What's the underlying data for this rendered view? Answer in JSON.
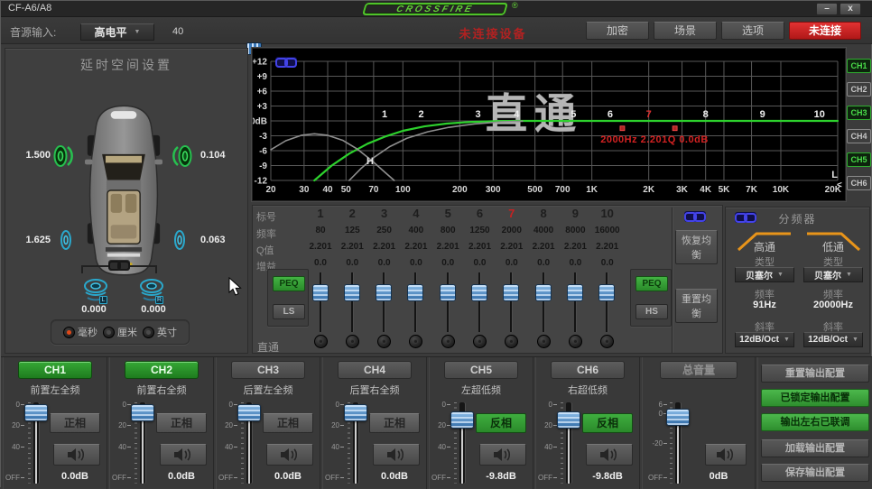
{
  "window": {
    "title": "CF-A6/A8",
    "logo_text": "CROSSFIRE",
    "logo_reg": "®",
    "minimize_glyph": "–",
    "close_glyph": "x"
  },
  "toolbar": {
    "source_label": "音源输入:",
    "source_select": {
      "value": "高电平"
    },
    "gain_value": "40",
    "status_text": "未连接设备",
    "encrypt_button": "加密",
    "scene_button": "场景",
    "options_button": "选项",
    "connect_button": "未连接"
  },
  "delay_panel": {
    "title": "延时空间设置",
    "values": {
      "front_left": "1.500",
      "front_right": "0.104",
      "rear_left": "1.625",
      "rear_right": "0.063",
      "sub_left": "0.000",
      "sub_right": "0.000"
    },
    "sub_tags": {
      "left": "L",
      "right": "R"
    },
    "units": [
      {
        "label": "毫秒",
        "selected": true
      },
      {
        "label": "厘米",
        "selected": false
      },
      {
        "label": "英寸",
        "selected": false
      }
    ]
  },
  "graph": {
    "watermark": "直通",
    "selected_band_info": "2000Hz 2.201Q 0.0dB",
    "high_label": "H",
    "low_label": "L",
    "collapse_arrow": "<",
    "channel_buttons": [
      {
        "label": "CH1",
        "active": true
      },
      {
        "label": "CH2",
        "active": false
      },
      {
        "label": "CH3",
        "active": true
      },
      {
        "label": "CH4",
        "active": false
      },
      {
        "label": "CH5",
        "active": true
      },
      {
        "label": "CH6",
        "active": false
      }
    ]
  },
  "chart_data": {
    "type": "line",
    "x_scale": "log",
    "x_range": [
      20,
      20000
    ],
    "y_range": [
      -12,
      12
    ],
    "y_unit": "dB",
    "x_ticks": [
      [
        20,
        "20"
      ],
      [
        30,
        "30"
      ],
      [
        40,
        "40"
      ],
      [
        50,
        "50"
      ],
      [
        70,
        "70"
      ],
      [
        100,
        "100"
      ],
      [
        200,
        "200"
      ],
      [
        300,
        "300"
      ],
      [
        500,
        "500"
      ],
      [
        700,
        "700"
      ],
      [
        1000,
        "1K"
      ],
      [
        2000,
        "2K"
      ],
      [
        3000,
        "3K"
      ],
      [
        4000,
        "4K"
      ],
      [
        5000,
        "5K"
      ],
      [
        7000,
        "7K"
      ],
      [
        10000,
        "10K"
      ],
      [
        20000,
        "20K"
      ]
    ],
    "y_ticks": [
      [
        12,
        "+12"
      ],
      [
        9,
        "+9"
      ],
      [
        6,
        "+6"
      ],
      [
        3,
        "+3"
      ],
      [
        0,
        "0dB"
      ],
      [
        -3,
        "-3"
      ],
      [
        -6,
        "-6"
      ],
      [
        -9,
        "-9"
      ],
      [
        -12,
        "-12"
      ]
    ],
    "series": [
      {
        "name": "channel-response",
        "color": "#2dd12d",
        "width": 2.2,
        "points": [
          [
            34,
            -12
          ],
          [
            42,
            -9
          ],
          [
            52,
            -6.6
          ],
          [
            65,
            -4.6
          ],
          [
            80,
            -3.2
          ],
          [
            100,
            -2
          ],
          [
            130,
            -1.1
          ],
          [
            170,
            -0.55
          ],
          [
            230,
            -0.2
          ],
          [
            320,
            -0.05
          ],
          [
            420,
            0
          ],
          [
            20000,
            0
          ]
        ]
      },
      {
        "name": "lowpass-filter",
        "color": "#8f8f8f",
        "width": 1.6,
        "points": [
          [
            20,
            -5.8
          ],
          [
            24,
            -4
          ],
          [
            29,
            -2.9
          ],
          [
            34,
            -2.6
          ],
          [
            40,
            -2.9
          ],
          [
            48,
            -3.9
          ],
          [
            57,
            -5.6
          ],
          [
            68,
            -7.9
          ],
          [
            80,
            -10.3
          ],
          [
            90,
            -12
          ]
        ]
      },
      {
        "name": "highpass-filter",
        "color": "#8f8f8f",
        "width": 1.6,
        "points": [
          [
            52,
            -12
          ],
          [
            60,
            -9.6
          ],
          [
            70,
            -7.4
          ],
          [
            85,
            -5.2
          ],
          [
            105,
            -3.5
          ],
          [
            135,
            -2.2
          ],
          [
            175,
            -1.3
          ],
          [
            240,
            -0.6
          ],
          [
            330,
            -0.2
          ],
          [
            430,
            -0.05
          ]
        ]
      }
    ],
    "band_markers": {
      "frequencies": [
        80,
        125,
        250,
        400,
        800,
        1250,
        2000,
        4000,
        8000,
        16000
      ],
      "labels": [
        "1",
        "2",
        "3",
        "4",
        "5",
        "6",
        "7",
        "8",
        "9",
        "10"
      ],
      "selected_index": 6,
      "color": "#f0f0f0",
      "selected_color": "#e03030"
    },
    "extra_markers": [
      {
        "freq": 1450,
        "db": -1.5
      },
      {
        "freq": 2750,
        "db": -1.5
      }
    ]
  },
  "eq": {
    "row_labels": [
      "标号",
      "频率",
      "Q值",
      "增益"
    ],
    "bands": [
      {
        "num": "1",
        "freq": "80",
        "q": "2.201",
        "gain": "0.0",
        "selected": false
      },
      {
        "num": "2",
        "freq": "125",
        "q": "2.201",
        "gain": "0.0",
        "selected": false
      },
      {
        "num": "3",
        "freq": "250",
        "q": "2.201",
        "gain": "0.0",
        "selected": false
      },
      {
        "num": "4",
        "freq": "400",
        "q": "2.201",
        "gain": "0.0",
        "selected": false
      },
      {
        "num": "5",
        "freq": "800",
        "q": "2.201",
        "gain": "0.0",
        "selected": false
      },
      {
        "num": "6",
        "freq": "1250",
        "q": "2.201",
        "gain": "0.0",
        "selected": false
      },
      {
        "num": "7",
        "freq": "2000",
        "q": "2.201",
        "gain": "0.0",
        "selected": true
      },
      {
        "num": "8",
        "freq": "4000",
        "q": "2.201",
        "gain": "0.0",
        "selected": false
      },
      {
        "num": "9",
        "freq": "8000",
        "q": "2.201",
        "gain": "0.0",
        "selected": false
      },
      {
        "num": "10",
        "freq": "16000",
        "q": "2.201",
        "gain": "0.0",
        "selected": false
      }
    ],
    "left_filter_buttons": [
      {
        "label": "PEQ",
        "green": true
      },
      {
        "label": "LS",
        "green": false
      }
    ],
    "right_filter_buttons": [
      {
        "label": "PEQ",
        "green": true
      },
      {
        "label": "HS",
        "green": false
      }
    ],
    "mode_label": "直通",
    "restore_button": "恢复均衡",
    "reset_button": "重置均衡"
  },
  "crossover": {
    "title": "分频器",
    "sections": [
      {
        "name": "高通",
        "type_label": "类型",
        "type_value": "贝塞尔",
        "freq_label": "频率",
        "freq_value": "91Hz",
        "slope_label": "斜率",
        "slope_value": "12dB/Oct"
      },
      {
        "name": "低通",
        "type_label": "类型",
        "type_value": "贝塞尔",
        "freq_label": "频率",
        "freq_value": "20000Hz",
        "slope_label": "斜率",
        "slope_value": "12dB/Oct"
      }
    ]
  },
  "channels": [
    {
      "name": "CH1",
      "desc": "前置左全频",
      "active": true,
      "phase_label": "正相",
      "phase_inverted": false,
      "level": "0.0dB",
      "fader_frac": 0.03
    },
    {
      "name": "CH2",
      "desc": "前置右全频",
      "active": true,
      "phase_label": "正相",
      "phase_inverted": false,
      "level": "0.0dB",
      "fader_frac": 0.03
    },
    {
      "name": "CH3",
      "desc": "后置左全频",
      "active": false,
      "phase_label": "正相",
      "phase_inverted": false,
      "level": "0.0dB",
      "fader_frac": 0.03
    },
    {
      "name": "CH4",
      "desc": "后置右全频",
      "active": false,
      "phase_label": "正相",
      "phase_inverted": false,
      "level": "0.0dB",
      "fader_frac": 0.03
    },
    {
      "name": "CH5",
      "desc": "左超低频",
      "active": false,
      "phase_label": "反相",
      "phase_inverted": true,
      "level": "-9.8dB",
      "fader_frac": 0.14
    },
    {
      "name": "CH6",
      "desc": "右超低频",
      "active": false,
      "phase_label": "反相",
      "phase_inverted": true,
      "level": "-9.8dB",
      "fader_frac": 0.14
    }
  ],
  "channel_scale": [
    {
      "label": "0",
      "frac": 0.02
    },
    {
      "label": "20",
      "frac": 0.29
    },
    {
      "label": "40",
      "frac": 0.57
    },
    {
      "label": "OFF",
      "frac": 0.96
    }
  ],
  "master": {
    "name": "总音量",
    "level": "0dB",
    "fader_frac": 0.1,
    "scale": [
      {
        "label": "6",
        "frac": 0.02
      },
      {
        "label": "0",
        "frac": 0.14
      },
      {
        "label": "-20",
        "frac": 0.52
      },
      {
        "label": "OFF",
        "frac": 0.96
      }
    ]
  },
  "output_buttons": [
    {
      "label": "重置输出配置",
      "green": false
    },
    {
      "label": "已锁定输出配置",
      "green": true
    },
    {
      "label": "输出左右已联调",
      "green": true
    },
    {
      "label": "加载输出配置",
      "green": false
    },
    {
      "label": "保存输出配置",
      "green": false
    }
  ],
  "colors": {
    "accent_green": "#2f9e2f",
    "alert_red": "#cc2222",
    "link_blue": "#4343e8",
    "curve_green": "#2dd12d",
    "curve_gray": "#8f8f8f",
    "slope_orange": "#e8941a"
  }
}
